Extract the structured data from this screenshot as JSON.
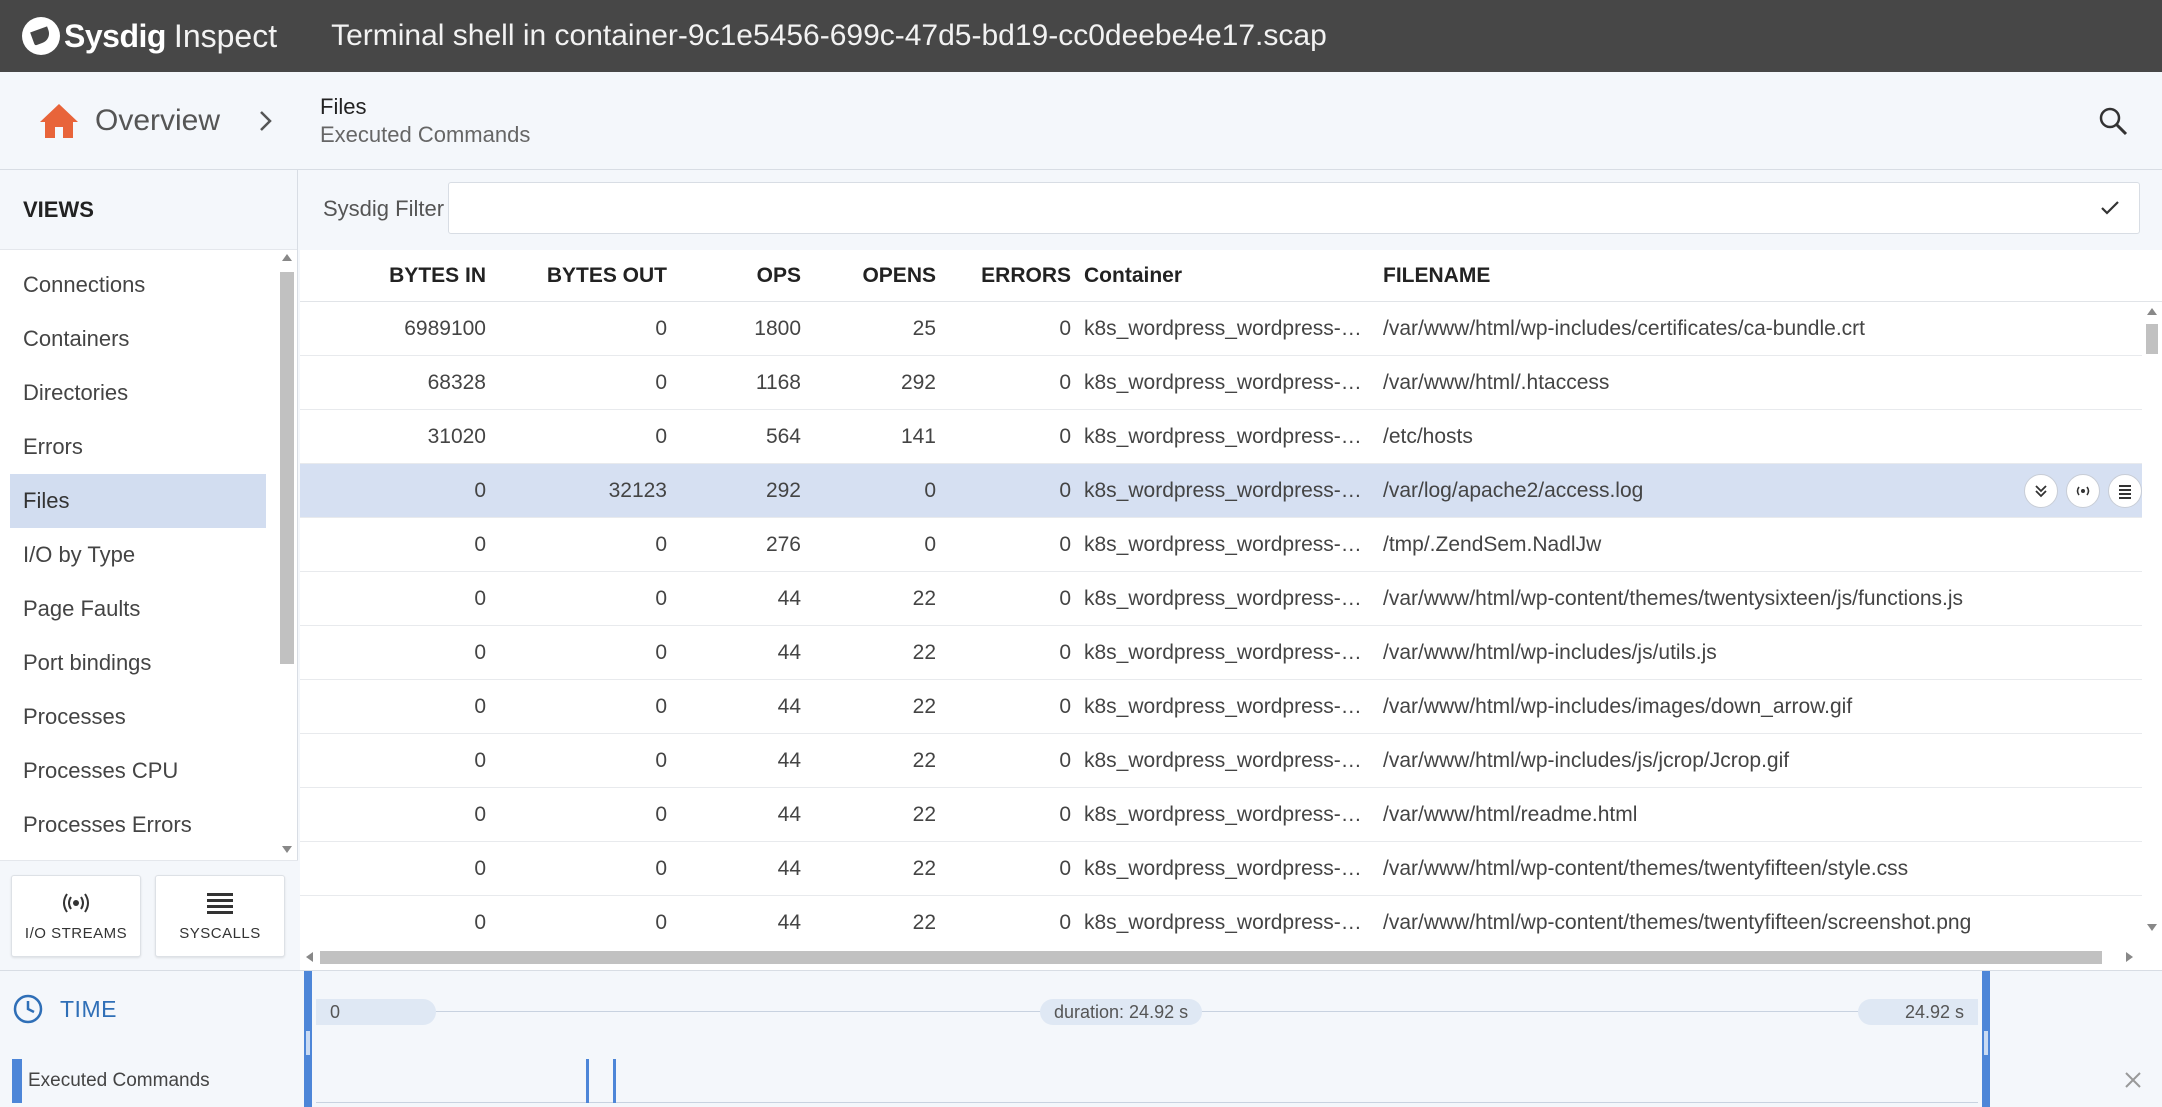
{
  "topbar": {
    "brand": "Sysdig",
    "product": "Inspect",
    "capture_title": "Terminal shell in container-9c1e5456-699c-47d5-bd19-cc0deebe4e17.scap"
  },
  "breadcrumb": {
    "home_label": "Overview",
    "current": "Files",
    "subtitle": "Executed Commands"
  },
  "sidebar": {
    "heading": "VIEWS",
    "items": [
      {
        "label": "Connections"
      },
      {
        "label": "Containers"
      },
      {
        "label": "Directories"
      },
      {
        "label": "Errors"
      },
      {
        "label": "Files"
      },
      {
        "label": "I/O by Type"
      },
      {
        "label": "Page Faults"
      },
      {
        "label": "Port bindings"
      },
      {
        "label": "Processes"
      },
      {
        "label": "Processes CPU"
      },
      {
        "label": "Processes Errors"
      }
    ],
    "active_index": 4,
    "io_streams_label": "I/O STREAMS",
    "syscalls_label": "SYSCALLS"
  },
  "filter": {
    "label": "Sysdig Filter",
    "value": ""
  },
  "table": {
    "columns": [
      "BYTES IN",
      "BYTES OUT",
      "OPS",
      "OPENS",
      "ERRORS",
      "Container",
      "FILENAME"
    ],
    "selected_row": 3,
    "rows": [
      [
        "6989100",
        "0",
        "1800",
        "25",
        "0",
        "k8s_wordpress_wordpress-1...",
        "/var/www/html/wp-includes/certificates/ca-bundle.crt"
      ],
      [
        "68328",
        "0",
        "1168",
        "292",
        "0",
        "k8s_wordpress_wordpress-1...",
        "/var/www/html/.htaccess"
      ],
      [
        "31020",
        "0",
        "564",
        "141",
        "0",
        "k8s_wordpress_wordpress-1...",
        "/etc/hosts"
      ],
      [
        "0",
        "32123",
        "292",
        "0",
        "0",
        "k8s_wordpress_wordpress-1...",
        "/var/log/apache2/access.log"
      ],
      [
        "0",
        "0",
        "276",
        "0",
        "0",
        "k8s_wordpress_wordpress-1...",
        "/tmp/.ZendSem.NadlJw"
      ],
      [
        "0",
        "0",
        "44",
        "22",
        "0",
        "k8s_wordpress_wordpress-1...",
        "/var/www/html/wp-content/themes/twentysixteen/js/functions.js"
      ],
      [
        "0",
        "0",
        "44",
        "22",
        "0",
        "k8s_wordpress_wordpress-1...",
        "/var/www/html/wp-includes/js/utils.js"
      ],
      [
        "0",
        "0",
        "44",
        "22",
        "0",
        "k8s_wordpress_wordpress-1...",
        "/var/www/html/wp-includes/images/down_arrow.gif"
      ],
      [
        "0",
        "0",
        "44",
        "22",
        "0",
        "k8s_wordpress_wordpress-1...",
        "/var/www/html/wp-includes/js/jcrop/Jcrop.gif"
      ],
      [
        "0",
        "0",
        "44",
        "22",
        "0",
        "k8s_wordpress_wordpress-1...",
        "/var/www/html/readme.html"
      ],
      [
        "0",
        "0",
        "44",
        "22",
        "0",
        "k8s_wordpress_wordpress-1...",
        "/var/www/html/wp-content/themes/twentyfifteen/style.css"
      ],
      [
        "0",
        "0",
        "44",
        "22",
        "0",
        "k8s_wordpress_wordpress-1...",
        "/var/www/html/wp-content/themes/twentyfifteen/screenshot.png"
      ]
    ],
    "row_actions": [
      "expand-icon",
      "io-streams-icon",
      "syscalls-icon"
    ]
  },
  "time": {
    "heading": "TIME",
    "start": "0",
    "duration": "duration: 24.92 s",
    "end": "24.92 s",
    "track_label": "Executed Commands",
    "marks_seconds": [
      4.05,
      4.45
    ]
  },
  "colors": {
    "topbar": "#474747",
    "accent": "#4d86d8",
    "home": "#e8643a",
    "selected_row": "#d6e0f2"
  }
}
